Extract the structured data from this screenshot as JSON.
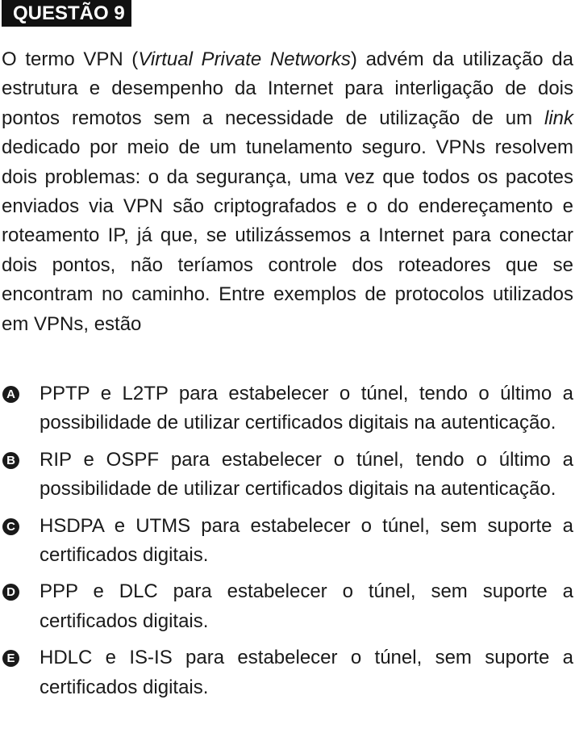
{
  "question": {
    "title": "QUESTÃO 9",
    "stem": {
      "part1": "O termo VPN (",
      "italic1": "Virtual Private Networks",
      "part2": ") advém da utilização da estrutura e desempenho da Internet para interligação de dois pontos remotos sem a necessidade de utilização de um ",
      "italic2": "link",
      "part3": " dedicado por meio de um tunelamento seguro. VPNs resolvem dois problemas: o da segurança, uma vez que todos os pacotes enviados via VPN são criptografados e o do endereçamento e roteamento IP, já que, se utilizássemos a Internet para conectar dois pontos, não teríamos controle dos roteadores que se encontram no caminho. Entre exemplos de protocolos utilizados em VPNs, estão"
    },
    "options": [
      {
        "letter": "A",
        "text": "PPTP e L2TP para estabelecer o túnel, tendo o último a possibilidade de utilizar certificados digitais na autenticação."
      },
      {
        "letter": "B",
        "text": "RIP e OSPF para estabelecer o túnel, tendo o último a possibilidade de utilizar certificados digitais na autenticação."
      },
      {
        "letter": "C",
        "text": "HSDPA e UTMS para estabelecer o túnel, sem suporte a certificados digitais."
      },
      {
        "letter": "D",
        "text": "PPP e DLC para estabelecer o túnel, sem suporte a certificados digitais."
      },
      {
        "letter": "E",
        "text": "HDLC e IS-IS para estabelecer o túnel, sem suporte a certificados digitais."
      }
    ]
  }
}
